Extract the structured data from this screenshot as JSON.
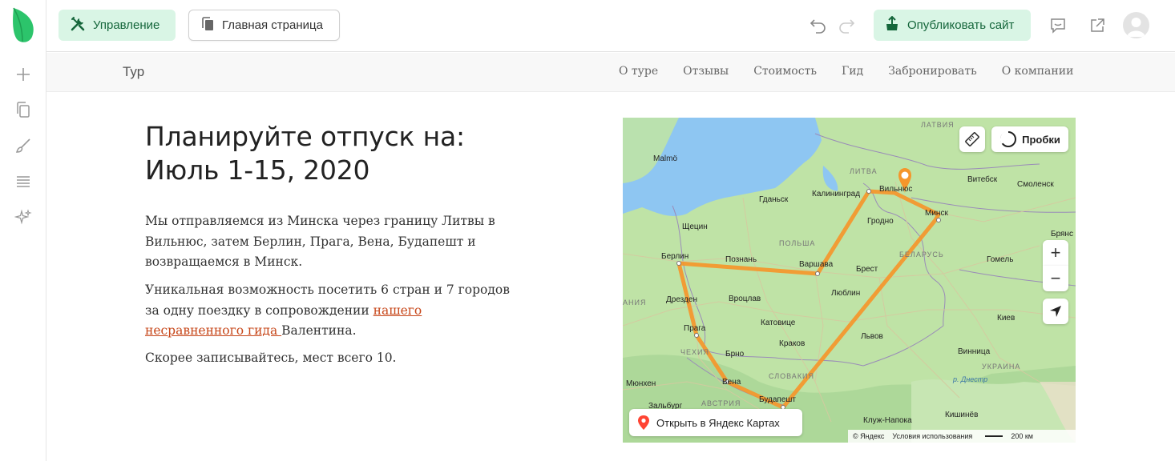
{
  "topbar": {
    "manage_label": "Управление",
    "home_label": "Главная страница",
    "publish_label": "Опубликовать сайт"
  },
  "site": {
    "brand": "Тур",
    "nav": [
      "О туре",
      "Отзывы",
      "Стоимость",
      "Гид",
      "Забронировать",
      "О компании"
    ]
  },
  "content": {
    "heading_line1": "Планируйте отпуск на:",
    "heading_line2": "Июль 1-15, 2020",
    "p1": "Мы отправляемся из Минска через границу Литвы в Вильнюс, затем Берлин, Прага, Вена, Будапешт и возвращаемся в Минск.",
    "p2_before": "Уникальная возможность посетить 6 стран и 7 городов за одну поездку в сопровождении ",
    "p2_link": "нашего несравненного гида ",
    "p2_after": "Валентина.",
    "p3": "Скорее записывайтесь, мест всего 10."
  },
  "map": {
    "traffic_label": "Пробки",
    "zoom_in": "+",
    "zoom_out": "−",
    "open_label": "Открыть в Яндекс Картах",
    "copyright": "© Яндекс",
    "terms": "Условия использования",
    "scale": "200 км",
    "cities": {
      "malmo": "Malmö",
      "gdansk": "Гданьск",
      "kaliningrad": "Калининград",
      "vilnius": "Вильнюс",
      "vitebsk": "Витебск",
      "smolensk": "Смоленск",
      "minsk": "Минск",
      "grodno": "Гродно",
      "bryansk": "Брянс",
      "szczecin": "Щецин",
      "berlin": "Берлин",
      "poznan": "Познань",
      "warsaw": "Варшава",
      "brest": "Брест",
      "gomel": "Гомель",
      "dresden": "Дрезден",
      "wroclaw": "Вроцлав",
      "lublin": "Люблин",
      "praha": "Прага",
      "katowice": "Катовице",
      "kyiv": "Киев",
      "krakow": "Краков",
      "lviv": "Львов",
      "brno": "Брно",
      "vinnytsia": "Винница",
      "munich": "Мюнхен",
      "vienna": "Вена",
      "salzburg": "Зальбург",
      "budapest": "Будапешт",
      "cluj": "Клуж-Напока",
      "chisinau": "Кишинёв"
    },
    "countries": {
      "latvia": "ЛАТВИЯ",
      "lithuania": "ЛИТВА",
      "poland": "ПОЛЬША",
      "belarus": "БЕЛАРУСЬ",
      "czech": "ЧЕХИЯ",
      "slovakia": "СЛОВАКИЯ",
      "austria": "АВСТРИЯ",
      "ukraine": "УКРАИНА",
      "germany": "АНИЯ"
    },
    "river": "р. Днестр"
  },
  "colors": {
    "accent_green": "#15663b",
    "accent_green_bg": "#d9f5e5",
    "link": "#c7471a",
    "route": "#f5962b"
  }
}
